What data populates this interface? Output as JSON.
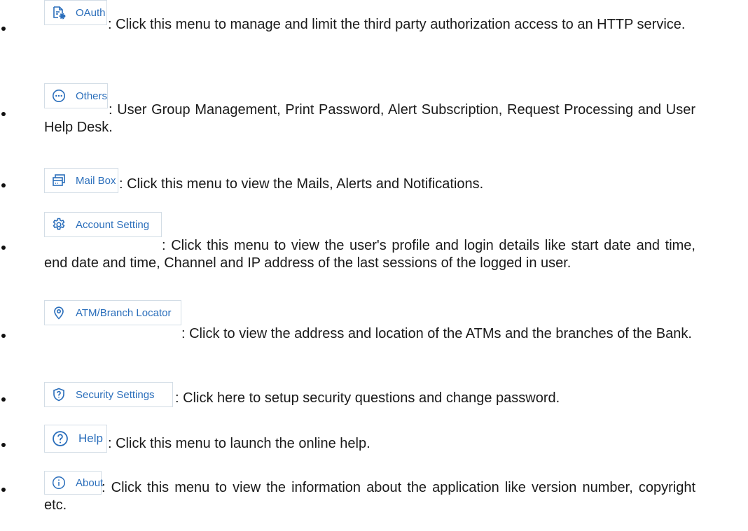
{
  "colors": {
    "accent": "#2a6ebb",
    "chip_border": "#d3dde6",
    "text": "#1a1a1a"
  },
  "items": [
    {
      "icon": "oauth-document-gear-icon",
      "label": "OAuth",
      "description": ": Click this menu to manage and limit the third party authorization access to an HTTP service."
    },
    {
      "icon": "ellipsis-circle-icon",
      "label": "Others",
      "description": ": User Group Management, Print Password, Alert Subscription, Request Processing and User Help Desk."
    },
    {
      "icon": "mailbox-icon",
      "label": "Mail Box",
      "description": ": Click this menu to view the Mails, Alerts and Notifications."
    },
    {
      "icon": "gear-icon",
      "label": "Account Setting",
      "description": ": Click this menu to view the user's profile and  login details like start date and time, end date and time, Channel and IP address of the last sessions of the  logged in user."
    },
    {
      "icon": "location-pin-icon",
      "label": "ATM/Branch Locator",
      "description": ": Click to view the address and location of the ATMs and the branches of the Bank."
    },
    {
      "icon": "shield-question-icon",
      "label": "Security Settings",
      "description": ": Click here to setup security questions and change password."
    },
    {
      "icon": "help-circle-icon",
      "label": "Help",
      "description": ": Click this menu to launch the online help."
    },
    {
      "icon": "info-circle-icon",
      "label": "About",
      "description": ": Click this menu to view the information about the application like version number, copyright etc."
    }
  ]
}
